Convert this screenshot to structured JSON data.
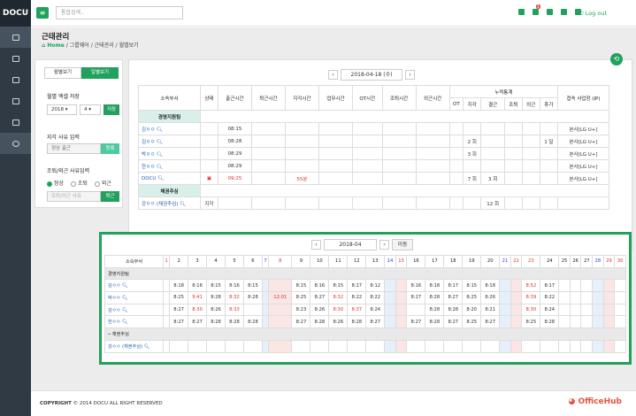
{
  "app": {
    "logo": "DOCU",
    "search_placeholder": "통합검색..",
    "logout": "Log out",
    "mail_badge": "3"
  },
  "page": {
    "title": "근태관리",
    "breadcrumb": [
      "Home",
      "그룹웨어",
      "근태관리",
      "월별보기"
    ]
  },
  "left": {
    "tab_month": "월별보기",
    "tab_day": "일별보기",
    "excel_label": "월별 엑셀 저장",
    "year": "2018",
    "month": "4",
    "save": "저장",
    "late_label": "지각 사유 입력",
    "late_value": "정상 출근",
    "register": "등록",
    "early_label": "조퇴/외근 사유입력",
    "radios": [
      "정상",
      "조퇴",
      "외근"
    ],
    "early_placeholder": "조퇴/외근 사유",
    "leave": "퇴근"
  },
  "daily": {
    "date": "2018-04-18 (수)",
    "headers": [
      "소속부서",
      "상태",
      "출근시간",
      "퇴근시간",
      "지각시간",
      "업무시간",
      "OT시간",
      "조퇴시간",
      "외근시간",
      "누적통계",
      "접속 사업장 (IP)"
    ],
    "stat_headers": [
      "OT",
      "지각",
      "결근",
      "조퇴",
      "외근",
      "휴가"
    ],
    "groups": [
      {
        "name": "경영지원팀",
        "rows": [
          {
            "name": "김ㅇㅇ",
            "status": "",
            "in": "08:15",
            "late": "",
            "stats": [
              "",
              "",
              "",
              "",
              "",
              ""
            ],
            "ip": "본사[LG U+]"
          },
          {
            "name": "김ㅇㅇ",
            "status": "",
            "in": "08:28",
            "late": "",
            "stats": [
              "",
              "2 회",
              "",
              "",
              "",
              "1 일"
            ],
            "ip": "본사[LG U+]"
          },
          {
            "name": "박ㅇㅇ",
            "status": "",
            "in": "08:29",
            "late": "",
            "stats": [
              "",
              "3 회",
              "",
              "",
              "",
              ""
            ],
            "ip": "본사[LG U+]"
          },
          {
            "name": "한ㅇㅇ",
            "status": "",
            "in": "08:29",
            "late": "",
            "stats": [
              "",
              "",
              "",
              "",
              "",
              ""
            ],
            "ip": "본사[LG U+]"
          },
          {
            "name": "DOCU",
            "status": "doc",
            "in": "09:25",
            "late": "55분",
            "stats": [
              "",
              "7 회",
              "3 회",
              "",
              "",
              ""
            ],
            "ip": "본사[LG U+]"
          }
        ]
      },
      {
        "name": "채권추심",
        "rows": [
          {
            "name": "강ㅇㅇ (채권추심)",
            "status": "지각",
            "in": "",
            "late": "",
            "stats": [
              "",
              "",
              "12 회",
              "",
              "",
              ""
            ],
            "ip": ""
          }
        ]
      }
    ]
  },
  "monthly": {
    "month": "2018-04",
    "move": "이동",
    "dept_header": "소속부서",
    "days": [
      "1",
      "2",
      "3",
      "4",
      "5",
      "6",
      "7",
      "8",
      "9",
      "10",
      "11",
      "12",
      "13",
      "14",
      "15",
      "16",
      "17",
      "18",
      "19",
      "20",
      "21",
      "22",
      "23",
      "24",
      "25",
      "26",
      "27",
      "28",
      "29",
      "30"
    ],
    "groups": [
      {
        "name": "경영지원팀",
        "rows": [
          {
            "name": "김ㅇㅇ",
            "times": [
              "",
              "8:18",
              "8:16",
              "8:15",
              "8:16",
              "8:15",
              "",
              "",
              "8:15",
              "8:16",
              "8:15",
              "8:17",
              "8:12",
              "",
              "",
              "8:16",
              "8:18",
              "8:17",
              "8:15",
              "8:18",
              "",
              "",
              "8:52",
              "8:17",
              "",
              "",
              "",
              "",
              "",
              ""
            ]
          },
          {
            "name": "박ㅇㅇ",
            "times": [
              "",
              "8:25",
              "9:41",
              "8:28",
              "8:32",
              "8:28",
              "",
              "12:01",
              "8:25",
              "8:27",
              "8:32",
              "8:22",
              "8:22",
              "",
              "",
              "8:27",
              "8:28",
              "8:27",
              "8:25",
              "8:26",
              "",
              "",
              "8:39",
              "8:22",
              "",
              "",
              "",
              "",
              "",
              ""
            ]
          },
          {
            "name": "김ㅇㅇ",
            "times": [
              "",
              "8:27",
              "8:30",
              "8:26",
              "8:33",
              "",
              "",
              "",
              "8:23",
              "8:26",
              "8:30",
              "8:37",
              "8:24",
              "",
              "",
              "",
              "8:28",
              "8:28",
              "8:20",
              "8:21",
              "",
              "",
              "8:30",
              "8:24",
              "",
              "",
              "",
              "",
              "",
              ""
            ]
          },
          {
            "name": "한ㅇㅇ",
            "times": [
              "",
              "8:27",
              "8:27",
              "8:28",
              "8:28",
              "8:28",
              "",
              "",
              "8:27",
              "8:28",
              "8:26",
              "8:28",
              "8:27",
              "",
              "",
              "8:27",
              "8:28",
              "8:27",
              "8:25",
              "8:27",
              "",
              "",
              "8:25",
              "8:28",
              "",
              "",
              "",
              "",
              "",
              ""
            ]
          }
        ]
      },
      {
        "name": "─ 채권추심",
        "rows": [
          {
            "name": "강ㅇㅇ (채권추심)",
            "times": [
              "",
              "",
              "",
              "",
              "",
              "",
              "",
              "",
              "",
              "",
              "",
              "",
              "",
              "",
              "",
              "",
              "",
              "",
              "",
              "",
              "",
              "",
              "",
              "",
              "",
              "",
              "",
              "",
              "",
              ""
            ]
          }
        ]
      }
    ]
  },
  "footer": {
    "copyright_bold": "COPYRIGHT",
    "copyright": "© 2014 DOCU ALL RIGHT RESERVED",
    "brand": "OfficeHub"
  }
}
